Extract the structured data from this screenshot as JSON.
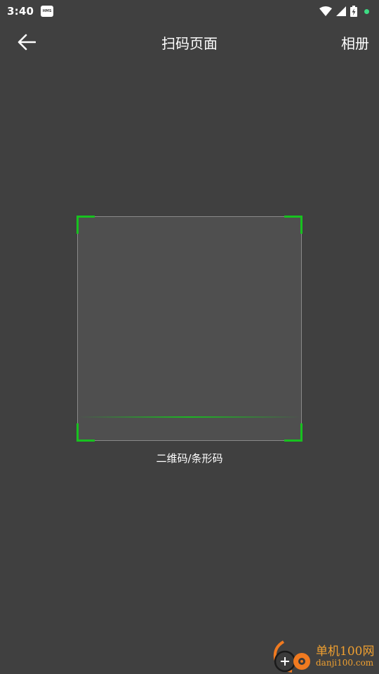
{
  "status_bar": {
    "time": "3:40",
    "badge": "HMS",
    "icons": [
      "wifi-icon",
      "cell-signal-icon",
      "battery-charging-icon",
      "notification-dot-icon"
    ],
    "dot_color": "#3ddc84"
  },
  "toolbar": {
    "back_icon": "arrow-left-icon",
    "title": "扫码页面",
    "album_label": "相册"
  },
  "scanner": {
    "hint": "二维码/条形码",
    "accent_color": "#17c21f"
  },
  "watermark": {
    "title": "单机100网",
    "url": "danji100.com"
  }
}
